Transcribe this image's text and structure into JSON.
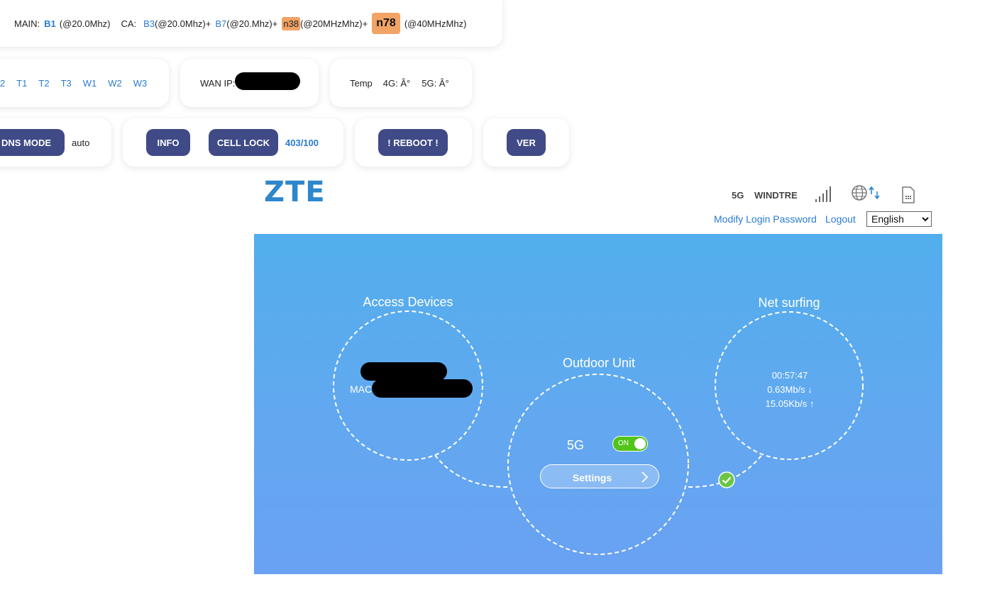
{
  "band_info": {
    "main_label": "MAIN:",
    "main_band": "B1",
    "main_bw": "(@20.0Mhz)",
    "ca_label": "CA:",
    "ca_b3": "B3",
    "ca_b3_bw": "(@20.0Mhz)+",
    "ca_b7": "B7",
    "ca_b7_bw": "(@20.Mhz)+",
    "ca_n38": "n38",
    "ca_n38_bw": "(@20MHzMhz)+",
    "ca_n78": "n78",
    "ca_n78_bw": "(@40MHzMhz)"
  },
  "row2": {
    "modes": [
      "2",
      "T1",
      "T2",
      "T3",
      "W1",
      "W2",
      "W3"
    ],
    "wan_ip_label": "WAN IP:",
    "temp_label": "Temp",
    "temp_4g": "4G: Â°",
    "temp_5g": "5G: Â°"
  },
  "row3": {
    "dns_mode_button": "DNS MODE",
    "dns_mode_value": "auto",
    "info_button": "INFO",
    "cell_lock_button": "CELL LOCK",
    "cell_lock_value": "403/100",
    "reboot_button": "! REBOOT !",
    "ver_button": "VER"
  },
  "header": {
    "logo": "ZTE",
    "network_type": "5G",
    "carrier": "WINDTRE",
    "signal_icon": "signal-bars-icon",
    "internet_icon": "globe-updown-icon",
    "sim_icon": "sim-card-icon",
    "modify_password": "Modify Login Password",
    "logout": "Logout",
    "language": "English",
    "language_options": [
      "English"
    ]
  },
  "panel": {
    "access_devices_title": "Access Devices",
    "access_devices_mac": "MAC",
    "outdoor_unit_title": "Outdoor Unit",
    "outdoor_5g_label": "5G",
    "toggle_state": "ON",
    "settings_button": "Settings",
    "net_surfing_title": "Net surfing",
    "uptime": "00:57:47",
    "download_speed": "0.63Mb/s ↓",
    "upload_speed": "15.05Kb/s ↑",
    "colors": {
      "panel_top": "#52aeec",
      "panel_bottom": "#6aa1f2",
      "toggle_on": "#52c41a",
      "check": "#6cc644"
    }
  }
}
